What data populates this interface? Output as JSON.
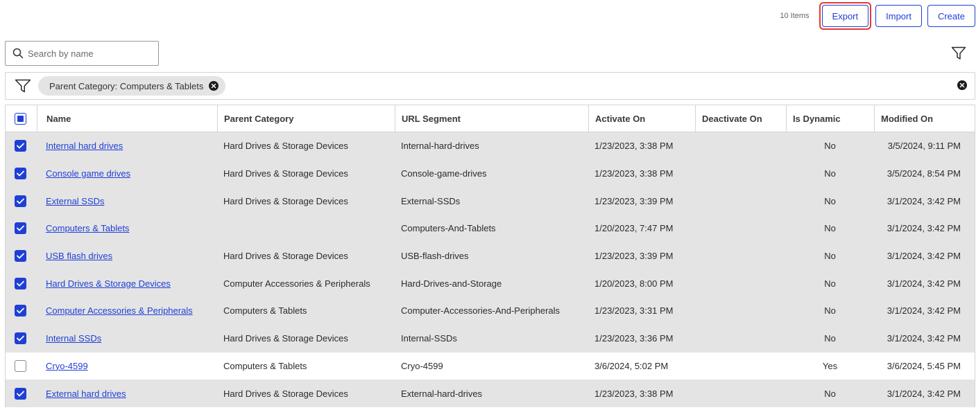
{
  "toolbar": {
    "item_count": "10 Items",
    "export_label": "Export",
    "import_label": "Import",
    "create_label": "Create"
  },
  "search": {
    "placeholder": "Search by name"
  },
  "filter": {
    "chip_label": "Parent Category: Computers & Tablets"
  },
  "table": {
    "headers": {
      "name": "Name",
      "parent": "Parent Category",
      "url": "URL Segment",
      "activate": "Activate On",
      "deactivate": "Deactivate On",
      "dynamic": "Is Dynamic",
      "modified": "Modified On"
    },
    "rows": [
      {
        "selected": true,
        "name": "Internal hard drives",
        "parent": "Hard Drives & Storage Devices",
        "url": "Internal-hard-drives",
        "activate": "1/23/2023, 3:38 PM",
        "deactivate": "",
        "dynamic": "No",
        "modified": "3/5/2024, 9:11 PM"
      },
      {
        "selected": true,
        "name": "Console game drives",
        "parent": "Hard Drives & Storage Devices",
        "url": "Console-game-drives",
        "activate": "1/23/2023, 3:38 PM",
        "deactivate": "",
        "dynamic": "No",
        "modified": "3/5/2024, 8:54 PM"
      },
      {
        "selected": true,
        "name": "External SSDs",
        "parent": "Hard Drives & Storage Devices",
        "url": "External-SSDs",
        "activate": "1/23/2023, 3:39 PM",
        "deactivate": "",
        "dynamic": "No",
        "modified": "3/1/2024, 3:42 PM"
      },
      {
        "selected": true,
        "name": "Computers & Tablets",
        "parent": "",
        "url": "Computers-And-Tablets",
        "activate": "1/20/2023, 7:47 PM",
        "deactivate": "",
        "dynamic": "No",
        "modified": "3/1/2024, 3:42 PM"
      },
      {
        "selected": true,
        "name": "USB flash drives",
        "parent": "Hard Drives & Storage Devices",
        "url": "USB-flash-drives",
        "activate": "1/23/2023, 3:39 PM",
        "deactivate": "",
        "dynamic": "No",
        "modified": "3/1/2024, 3:42 PM"
      },
      {
        "selected": true,
        "name": "Hard Drives & Storage Devices",
        "parent": "Computer Accessories & Peripherals",
        "url": "Hard-Drives-and-Storage",
        "activate": "1/20/2023, 8:00 PM",
        "deactivate": "",
        "dynamic": "No",
        "modified": "3/1/2024, 3:42 PM"
      },
      {
        "selected": true,
        "name": "Computer Accessories & Peripherals",
        "parent": "Computers & Tablets",
        "url": "Computer-Accessories-And-Peripherals",
        "activate": "1/23/2023, 3:31 PM",
        "deactivate": "",
        "dynamic": "No",
        "modified": "3/1/2024, 3:42 PM"
      },
      {
        "selected": true,
        "name": "Internal SSDs",
        "parent": "Hard Drives & Storage Devices",
        "url": "Internal-SSDs",
        "activate": "1/23/2023, 3:36 PM",
        "deactivate": "",
        "dynamic": "No",
        "modified": "3/1/2024, 3:42 PM"
      },
      {
        "selected": false,
        "name": "Cryo-4599",
        "parent": "Computers & Tablets",
        "url": "Cryo-4599",
        "activate": "3/6/2024, 5:02 PM",
        "deactivate": "",
        "dynamic": "Yes",
        "modified": "3/6/2024, 5:45 PM"
      },
      {
        "selected": true,
        "name": "External hard drives",
        "parent": "Hard Drives & Storage Devices",
        "url": "External-hard-drives",
        "activate": "1/23/2023, 3:38 PM",
        "deactivate": "",
        "dynamic": "No",
        "modified": "3/1/2024, 3:42 PM"
      }
    ]
  },
  "colors": {
    "accent": "#1f3fd6",
    "selected_row": "#e4e4e4",
    "highlight_border": "#e53935"
  }
}
